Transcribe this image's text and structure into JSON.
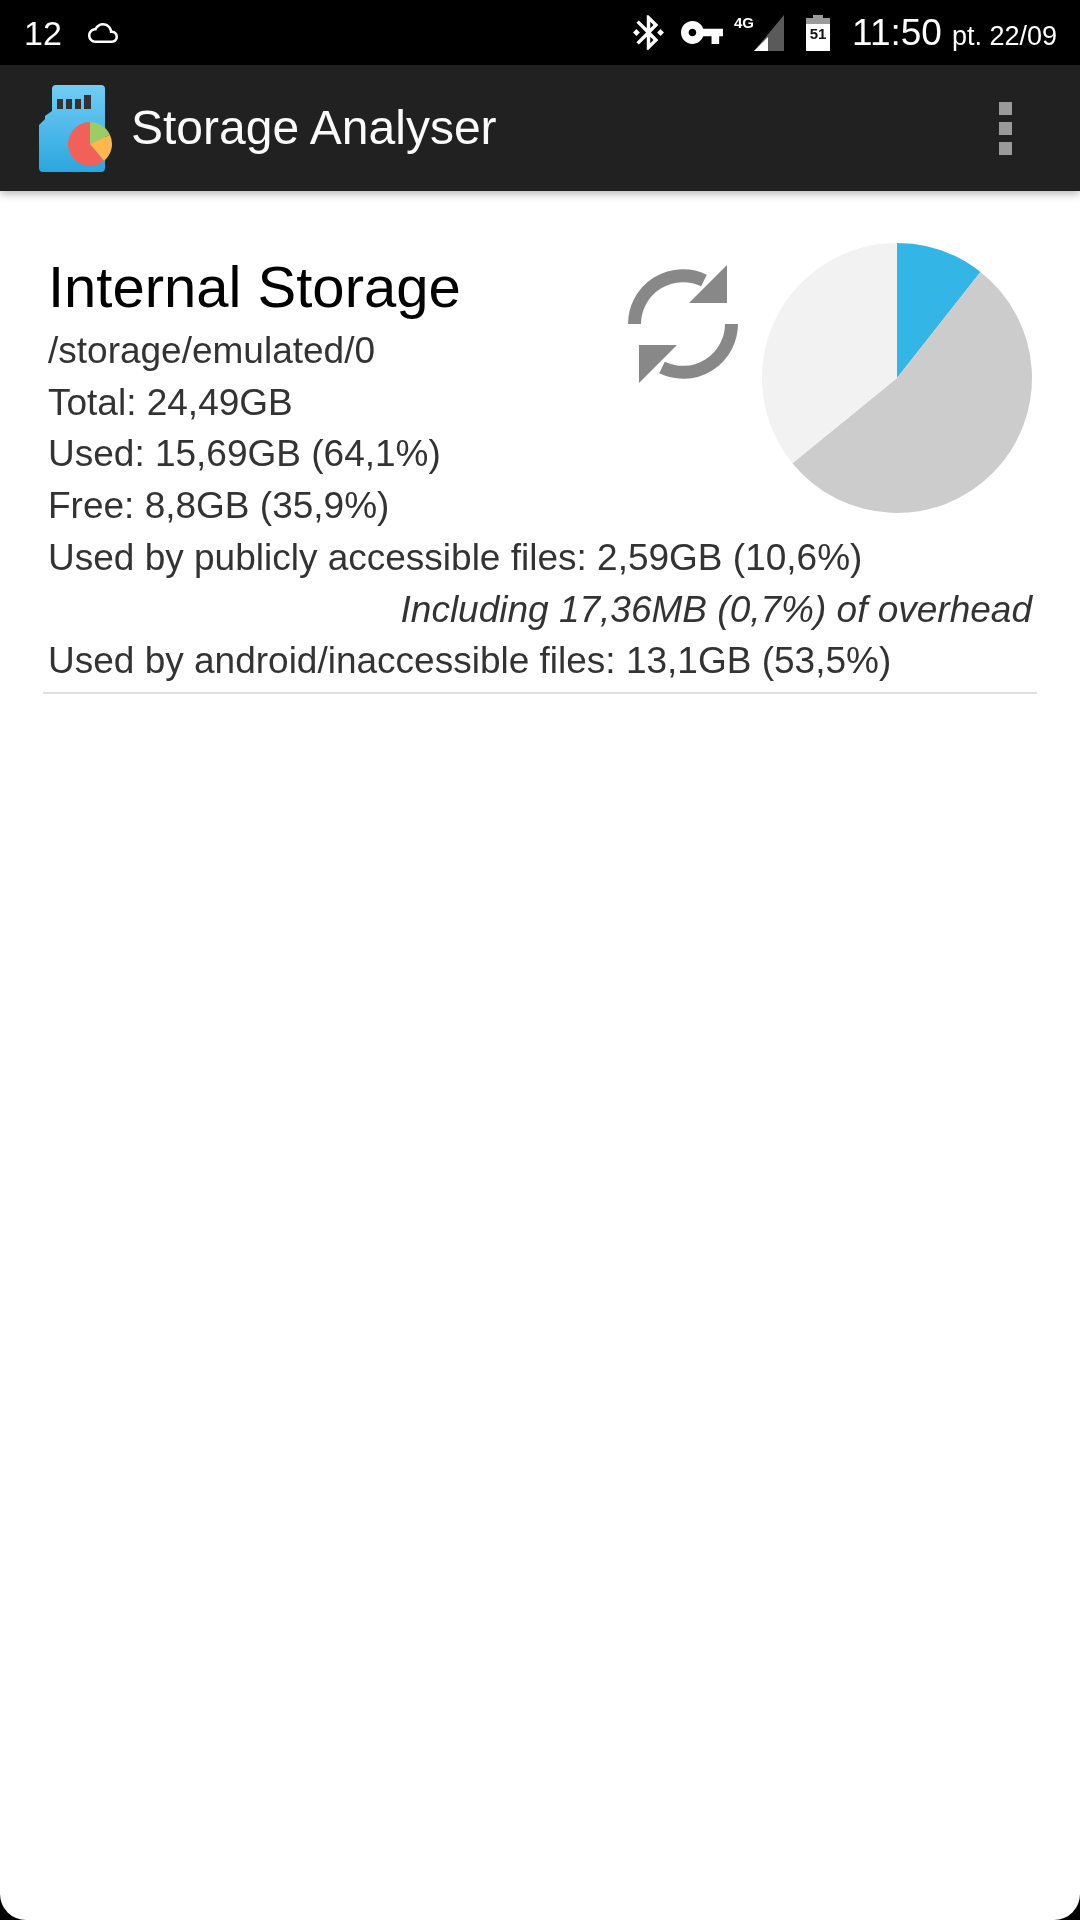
{
  "status_bar": {
    "left_text": "12",
    "network_type": "4G",
    "battery_text": "51",
    "time": "11:50",
    "date": "pt. 22/09"
  },
  "app_bar": {
    "title": "Storage Analyser"
  },
  "storage_card": {
    "title": "Internal Storage",
    "path": "/storage/emulated/0",
    "details": [
      {
        "kind": "plain",
        "text": "Total: 24,49GB"
      },
      {
        "kind": "plain",
        "text": "Used: 15,69GB (64,1%)"
      },
      {
        "kind": "plain",
        "text": "Free: 8,8GB (35,9%)"
      },
      {
        "kind": "plain",
        "text": "Used by publicly accessible files: 2,59GB (10,6%)"
      },
      {
        "kind": "note",
        "text": "Including 17,36MB (0,7%) of overhead"
      },
      {
        "kind": "plain",
        "text": "Used by android/inaccessible files: 13,1GB (53,5%)"
      }
    ]
  }
}
